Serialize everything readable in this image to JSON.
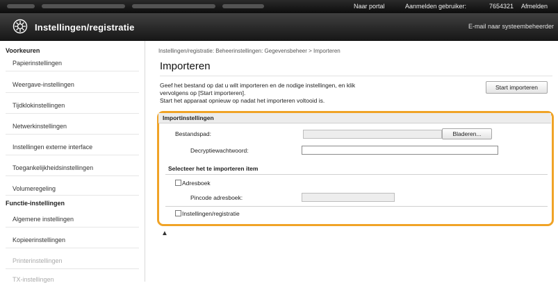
{
  "topbar": {
    "portal_link": "Naar portal",
    "login_label": "Aanmelden gebruiker:",
    "user_id": "7654321",
    "logout_label": "Afmelden"
  },
  "header": {
    "title": "Instellingen/registratie",
    "email_link": "E-mail naar systeembeheerder"
  },
  "sidebar": {
    "section1": "Voorkeuren",
    "items1": [
      "Papierinstellingen",
      "Weergave-instellingen",
      "Tijdklokinstellingen",
      "Netwerkinstellingen",
      "Instellingen externe interface",
      "Toegankelijkheidsinstellingen",
      "Volumeregeling"
    ],
    "section2": "Functie-instellingen",
    "items2": [
      "Algemene instellingen",
      "Kopieerinstellingen",
      "Printerinstellingen",
      "TX-instellingen"
    ]
  },
  "main": {
    "breadcrumb": "Instellingen/registratie: Beheerinstellingen: Gegevensbeheer > Importeren",
    "title": "Importeren",
    "desc1": "Geef het bestand op dat u wilt importeren en de nodige instellingen, en klik",
    "desc2": "vervolgens op [Start importeren].",
    "desc3": "Start het apparaat opnieuw op nadat het importeren voltooid is.",
    "start_button": "Start importeren",
    "panel_title": "Importinstellingen",
    "filepath_label": "Bestandspad:",
    "filepath_value": "",
    "browse_button": "Bladeren...",
    "password_label": "Decryptiewachtwoord:",
    "password_value": "",
    "select_heading": "Selecteer het te importeren item",
    "addressbook_label": "Adresboek",
    "pin_label": "Pincode adresboek:",
    "pin_value": "",
    "settings_label": "Instellingen/registratie",
    "top_arrow": "▲"
  }
}
